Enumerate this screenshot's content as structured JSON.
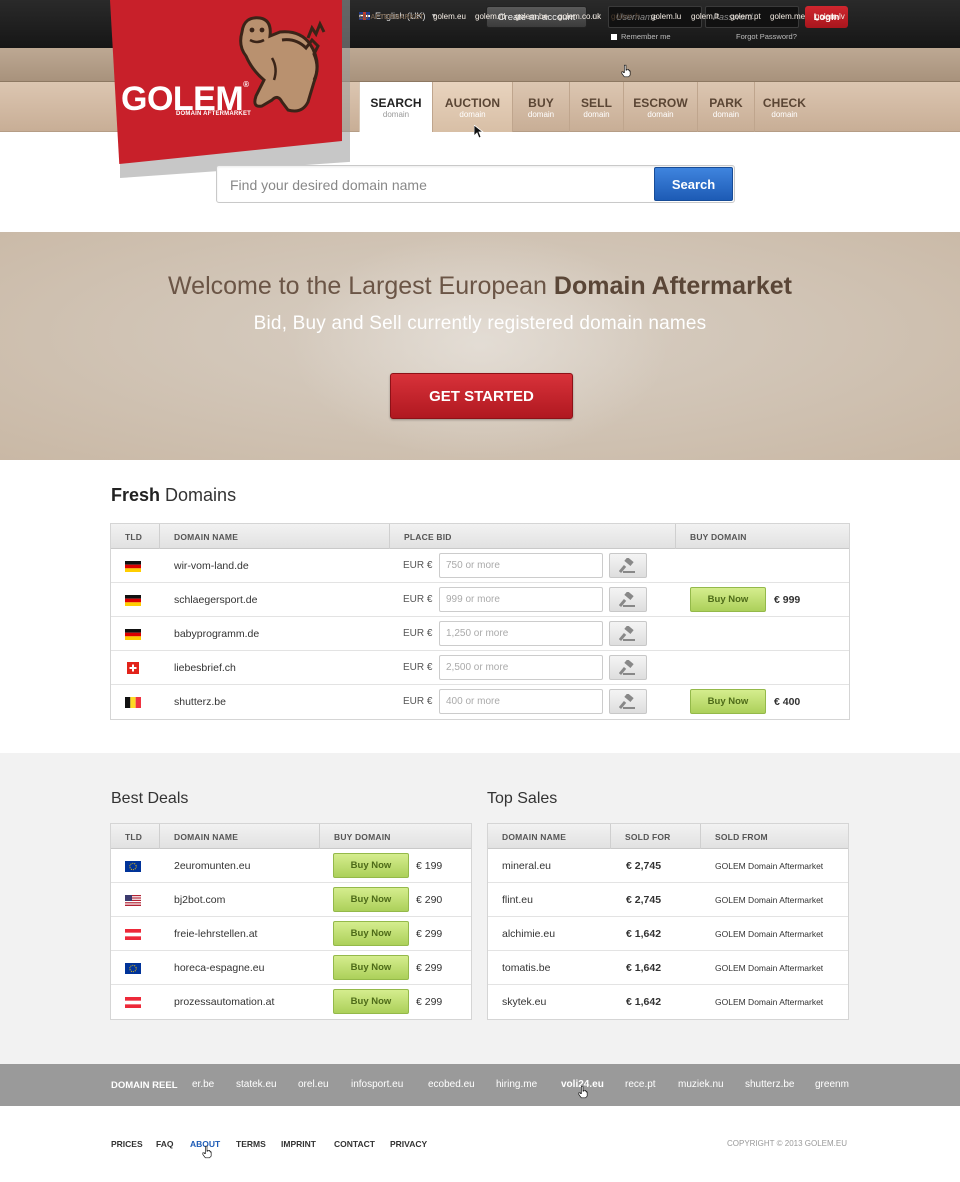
{
  "topbar": {
    "language": "English (UK)",
    "create_account": "Create an account",
    "or": "or",
    "username_placeholder": "Username",
    "password_placeholder": "Password",
    "login": "Login",
    "remember_me": "Remember me",
    "forgot_password": "Forgot Password?"
  },
  "logo": {
    "name": "GOLEM",
    "registered": "®",
    "tagline": "DOMAIN AFTERMARKET"
  },
  "eu_bar": {
    "label": "EU AFTERMARKET",
    "links": [
      "golem.eu",
      "golem.nl",
      "golem.be",
      "golem.co.uk",
      "golem.fr",
      "golem.lu",
      "golem.lt",
      "golem.pt",
      "golem.me",
      "golem.lv"
    ]
  },
  "nav": [
    {
      "title": "SEARCH",
      "sub": "domain"
    },
    {
      "title": "AUCTION",
      "sub": "domain"
    },
    {
      "title": "BUY",
      "sub": "domain"
    },
    {
      "title": "SELL",
      "sub": "domain"
    },
    {
      "title": "ESCROW",
      "sub": "domain"
    },
    {
      "title": "PARK",
      "sub": "domain"
    },
    {
      "title": "CHECK",
      "sub": "domain"
    }
  ],
  "search": {
    "placeholder": "Find your desired domain name",
    "button": "Search"
  },
  "hero": {
    "title_light": "Welcome to the Largest European",
    "title_bold": "Domain Aftermarket",
    "subtitle": "Bid, Buy and Sell currently registered domain names",
    "cta": "GET STARTED"
  },
  "fresh": {
    "title_bold": "Fresh",
    "title_light": "Domains",
    "columns": [
      "TLD",
      "DOMAIN NAME",
      "PLACE BID",
      "BUY DOMAIN"
    ],
    "currency": "EUR €",
    "rows": [
      {
        "flag": "de",
        "domain": "wir-vom-land.de",
        "bid": "750 or more",
        "buy": "",
        "price": ""
      },
      {
        "flag": "de",
        "domain": "schlaegersport.de",
        "bid": "999 or more",
        "buy": "Buy Now",
        "price": "€ 999"
      },
      {
        "flag": "de",
        "domain": "babyprogramm.de",
        "bid": "1,250 or more",
        "buy": "",
        "price": ""
      },
      {
        "flag": "ch",
        "domain": "liebesbrief.ch",
        "bid": "2,500 or more",
        "buy": "",
        "price": ""
      },
      {
        "flag": "be",
        "domain": "shutterz.be",
        "bid": "400 or more",
        "buy": "Buy Now",
        "price": "€ 400"
      }
    ]
  },
  "best_deals": {
    "title": "Best Deals",
    "columns": [
      "TLD",
      "DOMAIN NAME",
      "BUY DOMAIN"
    ],
    "rows": [
      {
        "flag": "eu",
        "domain": "2euromunten.eu",
        "buy": "Buy Now",
        "price": "€ 199"
      },
      {
        "flag": "us",
        "domain": "bj2bot.com",
        "buy": "Buy Now",
        "price": "€ 290"
      },
      {
        "flag": "at",
        "domain": "freie-lehrstellen.at",
        "buy": "Buy Now",
        "price": "€ 299"
      },
      {
        "flag": "eu",
        "domain": "horeca-espagne.eu",
        "buy": "Buy Now",
        "price": "€ 299"
      },
      {
        "flag": "at",
        "domain": "prozessautomation.at",
        "buy": "Buy Now",
        "price": "€ 299"
      }
    ]
  },
  "top_sales": {
    "title": "Top Sales",
    "columns": [
      "DOMAIN NAME",
      "SOLD FOR",
      "SOLD FROM"
    ],
    "rows": [
      {
        "domain": "mineral.eu",
        "price": "€ 2,745",
        "from": "GOLEM Domain Aftermarket"
      },
      {
        "domain": "flint.eu",
        "price": "€ 2,745",
        "from": "GOLEM Domain Aftermarket"
      },
      {
        "domain": "alchimie.eu",
        "price": "€ 1,642",
        "from": "GOLEM Domain Aftermarket"
      },
      {
        "domain": "tomatis.be",
        "price": "€ 1,642",
        "from": "GOLEM Domain Aftermarket"
      },
      {
        "domain": "skytek.eu",
        "price": "€ 1,642",
        "from": "GOLEM Domain Aftermarket"
      }
    ]
  },
  "reel": {
    "label": "DOMAIN REEL",
    "items": [
      "er.be",
      "statek.eu",
      "orel.eu",
      "infosport.eu",
      "ecobed.eu",
      "hiring.me",
      "voli24.eu",
      "rece.pt",
      "muziek.nu",
      "shutterz.be",
      "greenm"
    ]
  },
  "footer": {
    "links": [
      "PRICES",
      "FAQ",
      "ABOUT",
      "TERMS",
      "IMPRINT",
      "CONTACT",
      "PRIVACY"
    ],
    "copyright": "COPYRIGHT © 2013 GOLEM.EU"
  },
  "colors": {
    "brand_red": "#c8202a",
    "search_blue": "#1d5bb5",
    "buy_green": "#acd05a",
    "link_blue": "#1d5bb5"
  }
}
